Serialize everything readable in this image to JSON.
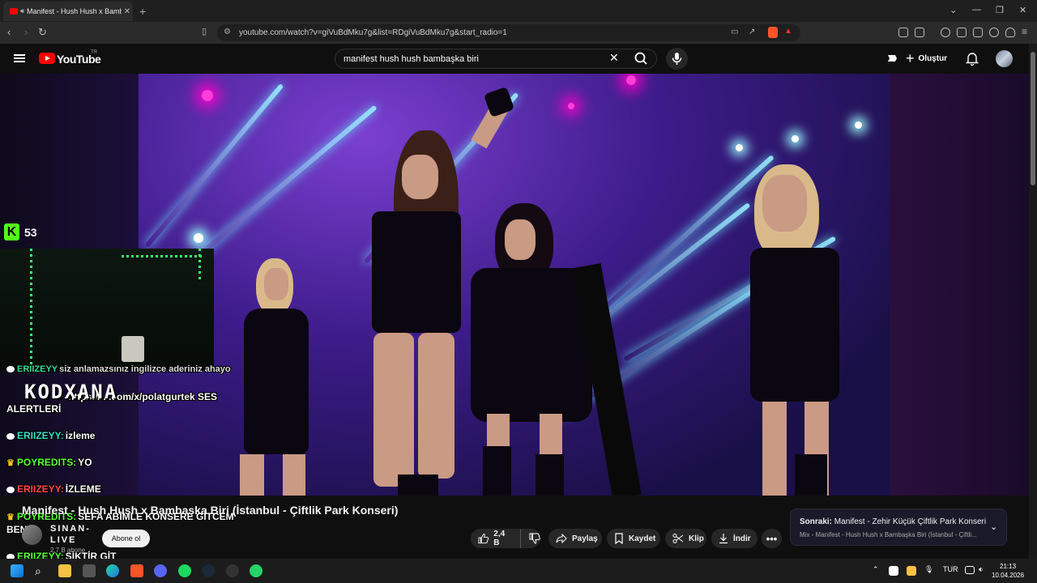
{
  "browser": {
    "tab_title": "Manifest - Hush Hush x Bambı",
    "url": "youtube.com/watch?v=giVuBdMku7g&list=RDgiVuBdMku7g&start_radio=1"
  },
  "youtube": {
    "logo_text": "YouTube",
    "logo_sup": "TR",
    "search_value": "manifest hush hush bambaşka biri",
    "create_label": "Oluştur"
  },
  "stream_overlay": {
    "platform_logo": "K",
    "viewer_count": "53",
    "channel_watermark": "KODXANA",
    "chat": [
      {
        "user": "ERIIZEYY",
        "message": "siz anlamazsınız ingilizce aderiniz ahayo"
      },
      {
        "user": "",
        "message": "https://....com/x/polatgurtek SES"
      },
      {
        "user": "",
        "message": "ALERTLERİ"
      },
      {
        "user": "ERIIZEYY:",
        "message": "izleme"
      },
      {
        "user": "POYREDITS:",
        "message": "YO"
      },
      {
        "user": "ERIIZEYY:",
        "message": "İZLEME"
      },
      {
        "user": "POYREDITS:",
        "message": "SEFA ABİMLE KONSERE GİTCEM"
      },
      {
        "user": "",
        "message": "BEN"
      },
      {
        "user": "ERIIZEYY:",
        "message": "SİKTİR GİT"
      }
    ]
  },
  "video": {
    "title": "Manifest - Hush Hush x Bambaşka Biri (İstanbul - Çiftlik Park Konseri)",
    "channel_name": "SINAN-LIVE",
    "subscribers": "2,7 B abone",
    "subscribe_label": "Abone ol",
    "like_count": "2,4 B",
    "share_label": "Paylaş",
    "save_label": "Kaydet",
    "clip_label": "Klip",
    "download_label": "İndir"
  },
  "up_next": {
    "prefix": "Sonraki:",
    "title": "Manifest - Zehir Küçük Çiftlik Park Konseri",
    "subtitle": "Mix - Manifest - Hush Hush x Bambaşka Biri (İstanbul - Çiftli..."
  },
  "taskbar": {
    "language": "TUR",
    "time": "21:13",
    "date": "10.04.2026"
  },
  "colors": {
    "youtube_red": "#ff0000",
    "kick_green": "#53fc18",
    "beam_cyan": "#6ee0ff"
  }
}
